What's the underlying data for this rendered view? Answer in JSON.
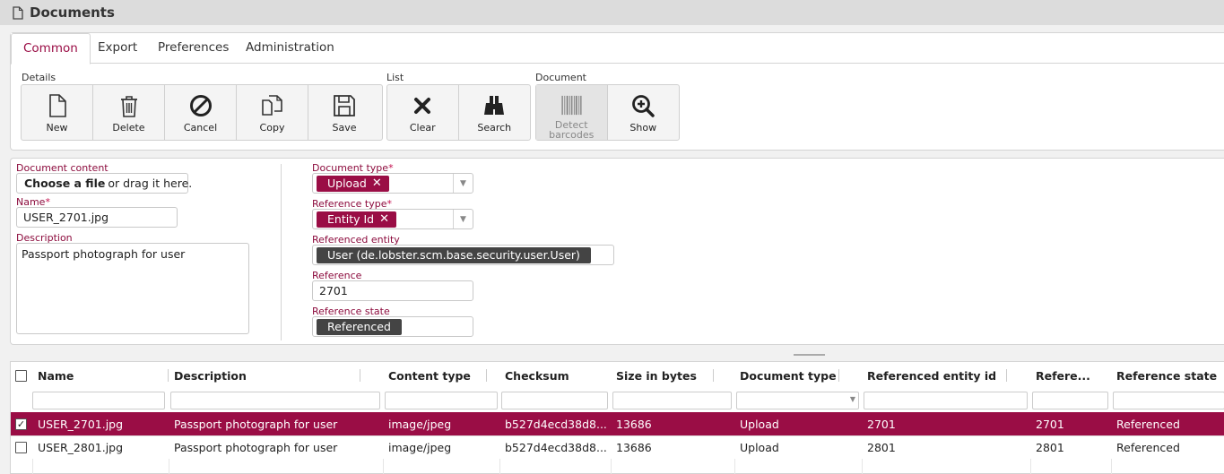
{
  "window": {
    "title": "Documents",
    "icon": "document-icon"
  },
  "tabs": [
    {
      "label": "Common",
      "active": true
    },
    {
      "label": "Export",
      "active": false
    },
    {
      "label": "Preferences",
      "active": false
    },
    {
      "label": "Administration",
      "active": false
    }
  ],
  "toolbar": {
    "groups": {
      "details": "Details",
      "list": "List",
      "document": "Document"
    },
    "buttons": {
      "new": "New",
      "delete": "Delete",
      "cancel": "Cancel",
      "copy": "Copy",
      "save": "Save",
      "clear": "Clear",
      "search": "Search",
      "detect_barcodes_1": "Detect",
      "detect_barcodes_2": "barcodes",
      "show": "Show"
    }
  },
  "form": {
    "document_content": {
      "label": "Document content",
      "button_strong": "Choose a file",
      "button_rest": "or drag it here."
    },
    "name": {
      "label": "Name",
      "value": "USER_2701.jpg"
    },
    "description": {
      "label": "Description",
      "value": "Passport photograph for user"
    },
    "document_type": {
      "label": "Document type",
      "value": "Upload"
    },
    "reference_type": {
      "label": "Reference type",
      "value": "Entity Id"
    },
    "referenced_entity": {
      "label": "Referenced entity",
      "value": "User (de.lobster.scm.base.security.user.User)"
    },
    "reference": {
      "label": "Reference",
      "value": "2701"
    },
    "reference_state": {
      "label": "Reference state",
      "value": "Referenced"
    },
    "required_mark": "*"
  },
  "grid": {
    "columns": {
      "name": "Name",
      "description": "Description",
      "content_type": "Content type",
      "checksum": "Checksum",
      "size": "Size in bytes",
      "document_type": "Document type",
      "referenced_entity_id": "Referenced entity id",
      "reference": "Refere...",
      "reference_state": "Reference state"
    },
    "rows": [
      {
        "selected": true,
        "check": "✓",
        "name": "USER_2701.jpg",
        "description": "Passport photograph for user",
        "content_type": "image/jpeg",
        "checksum": "b527d4ecd38d8...",
        "size": "13686",
        "document_type": "Upload",
        "referenced_entity_id": "2701",
        "reference": "2701",
        "reference_state": "Referenced"
      },
      {
        "selected": false,
        "check": "",
        "name": "USER_2801.jpg",
        "description": "Passport photograph for user",
        "content_type": "image/jpeg",
        "checksum": "b527d4ecd38d8...",
        "size": "13686",
        "document_type": "Upload",
        "referenced_entity_id": "2801",
        "reference": "2801",
        "reference_state": "Referenced"
      }
    ]
  },
  "colors": {
    "accent": "#9a0d45",
    "chip_dark": "#444444"
  }
}
